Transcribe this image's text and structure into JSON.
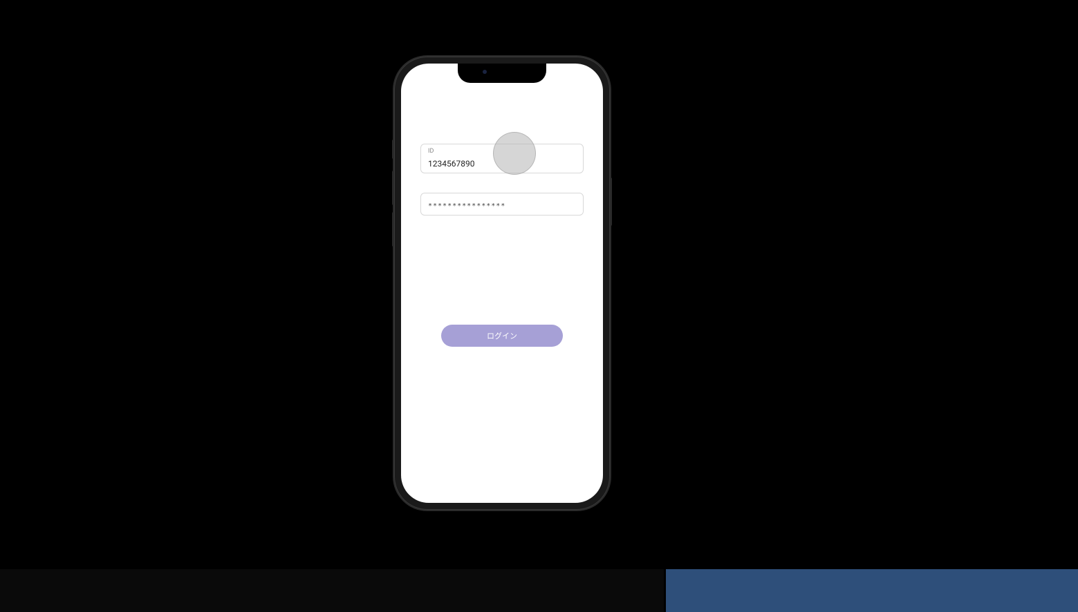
{
  "login": {
    "id_label": "ID",
    "id_value": "1234567890",
    "password_value": "****************",
    "button_label": "ログイン"
  },
  "colors": {
    "button_bg": "#a6a0d6",
    "input_border": "#d8d8d8"
  }
}
